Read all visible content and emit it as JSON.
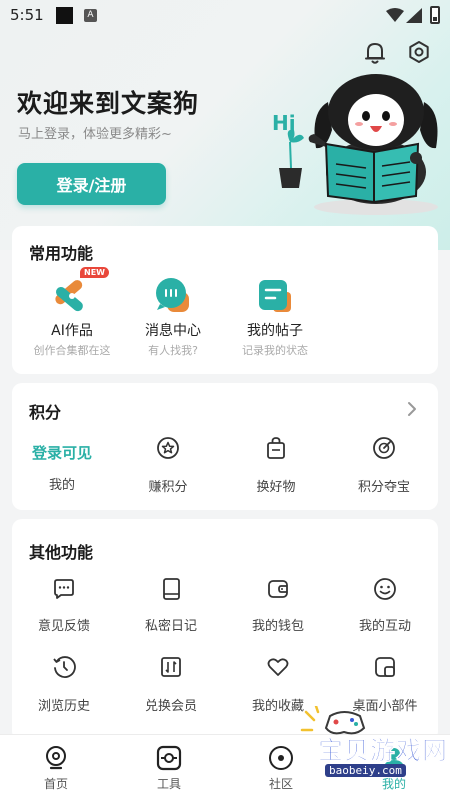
{
  "status_bar": {
    "time": "5:51",
    "a_badge": "A"
  },
  "header": {
    "title": "欢迎来到文案狗",
    "subtitle": "马上登录，体验更多精彩~",
    "login_button": "登录/注册",
    "hi_text": "Hi"
  },
  "common": {
    "title": "常用功能",
    "new_badge": "NEW",
    "items": [
      {
        "label": "AI作品",
        "sub": "创作合集都在这",
        "icon": "ai-works-icon"
      },
      {
        "label": "消息中心",
        "sub": "有人找我?",
        "icon": "message-icon"
      },
      {
        "label": "我的帖子",
        "sub": "记录我的状态",
        "icon": "posts-icon"
      }
    ]
  },
  "points": {
    "title": "积分",
    "login_visible": "登录可见",
    "mine": "我的",
    "items": [
      {
        "label": "赚积分",
        "icon": "earn-points-icon"
      },
      {
        "label": "换好物",
        "icon": "exchange-bag-icon"
      },
      {
        "label": "积分夺宝",
        "icon": "target-icon"
      }
    ]
  },
  "other": {
    "title": "其他功能",
    "items": [
      {
        "label": "意见反馈",
        "icon": "feedback-icon"
      },
      {
        "label": "私密日记",
        "icon": "diary-icon"
      },
      {
        "label": "我的钱包",
        "icon": "wallet-icon"
      },
      {
        "label": "我的互动",
        "icon": "smiley-icon"
      },
      {
        "label": "浏览历史",
        "icon": "history-icon"
      },
      {
        "label": "兑换会员",
        "icon": "redeem-icon"
      },
      {
        "label": "我的收藏",
        "icon": "heart-icon"
      },
      {
        "label": "桌面小部件",
        "icon": "widget-icon"
      }
    ]
  },
  "nav": {
    "items": [
      {
        "label": "首页",
        "icon": "home-icon"
      },
      {
        "label": "工具",
        "icon": "tools-icon"
      },
      {
        "label": "社区",
        "icon": "community-icon"
      },
      {
        "label": "我的",
        "icon": "profile-icon"
      }
    ]
  },
  "watermark": {
    "text": "宝贝游戏网",
    "url": "baobeiy.com"
  },
  "colors": {
    "accent": "#2ab0a6",
    "accent_light": "#e98a3a",
    "text_dark": "#1b1b1b",
    "text_grey": "#8a8a8a"
  }
}
